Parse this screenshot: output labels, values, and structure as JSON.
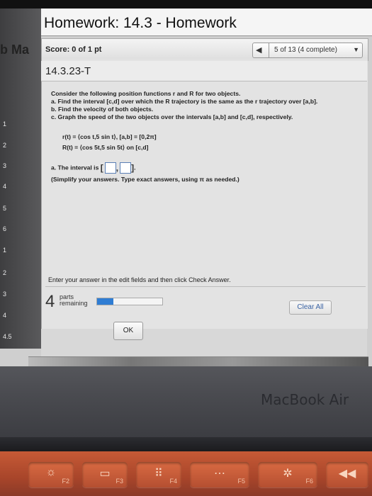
{
  "header": {
    "title": "Homework: 14.3 - Homework",
    "partial_title": "b Ma",
    "score": "Score: 0 of 1 pt",
    "progress": "5 of 13 (4 complete)"
  },
  "left_strip": [
    "1",
    "2",
    "3",
    "4",
    "5",
    "6",
    "1",
    "2",
    "3",
    "4",
    "4.5"
  ],
  "question": {
    "id": "14.3.23-T",
    "intro": "Consider the following position functions r and R for two objects.",
    "part_a": "a. Find the interval [c,d] over which the R trajectory is the same as the r trajectory over [a,b].",
    "part_b": "b. Find the velocity of both objects.",
    "part_c": "c. Graph the speed of the two objects over the intervals [a,b] and [c,d], respectively.",
    "r_func": "r(t) = ⟨cos t,5 sin t⟩, [a,b] = [0,2π]",
    "R_func": "R(t) = ⟨cos 5t,5 sin 5t⟩ on [c,d]",
    "answer_prompt": "a. The interval is",
    "answer_hint": "(Simplify your answers. Type exact answers, using π as needed.)"
  },
  "footer": {
    "instruction": "Enter your answer in the edit fields and then click Check Answer.",
    "parts_count": "4",
    "parts_label_1": "parts",
    "parts_label_2": "remaining",
    "progress_fraction": 0.25,
    "clear_all": "Clear All",
    "ok": "OK"
  },
  "device": {
    "label": "MacBook Air",
    "keys": [
      "F2",
      "F3",
      "F4",
      "F5",
      "F6"
    ]
  }
}
